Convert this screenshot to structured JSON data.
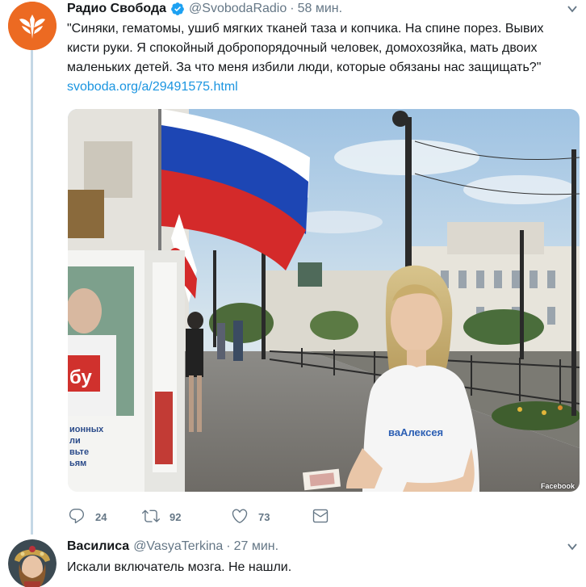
{
  "tweet": {
    "name": "Радио Свобода",
    "handle": "@SvobodaRadio",
    "time": "58 мин.",
    "text": "\"Синяки, гематомы, ушиб мягких тканей таза и копчика. На спине порез. Вывих кисти руки.  Я спокойный добропорядочный человек, домохозяйка, мать двоих маленьких детей. За что меня избили люди, которые обязаны нас защищать?\"",
    "link": "svoboda.org/a/29491575.html",
    "media_badge": "Facebook",
    "poster_text": "бу",
    "poster_lines": [
      "ионных",
      "ли",
      "вьте",
      "ьям"
    ],
    "tshirt_text": "ваАлексея",
    "replies": "24",
    "retweets": "92",
    "likes": "73",
    "icons": [
      "reply-icon",
      "retweet-icon",
      "like-icon",
      "dm-icon",
      "verified-icon",
      "caret-icon"
    ]
  },
  "reply": {
    "name": "Василиса",
    "handle": "@VasyaTerkina",
    "time": "27 мин.",
    "text": "Искали включатель мозга. Не нашли."
  },
  "colors": {
    "accent": "#1da1f2",
    "link": "#1b95e0",
    "muted": "#657786",
    "svoboda_orange": "#ec6a22"
  }
}
